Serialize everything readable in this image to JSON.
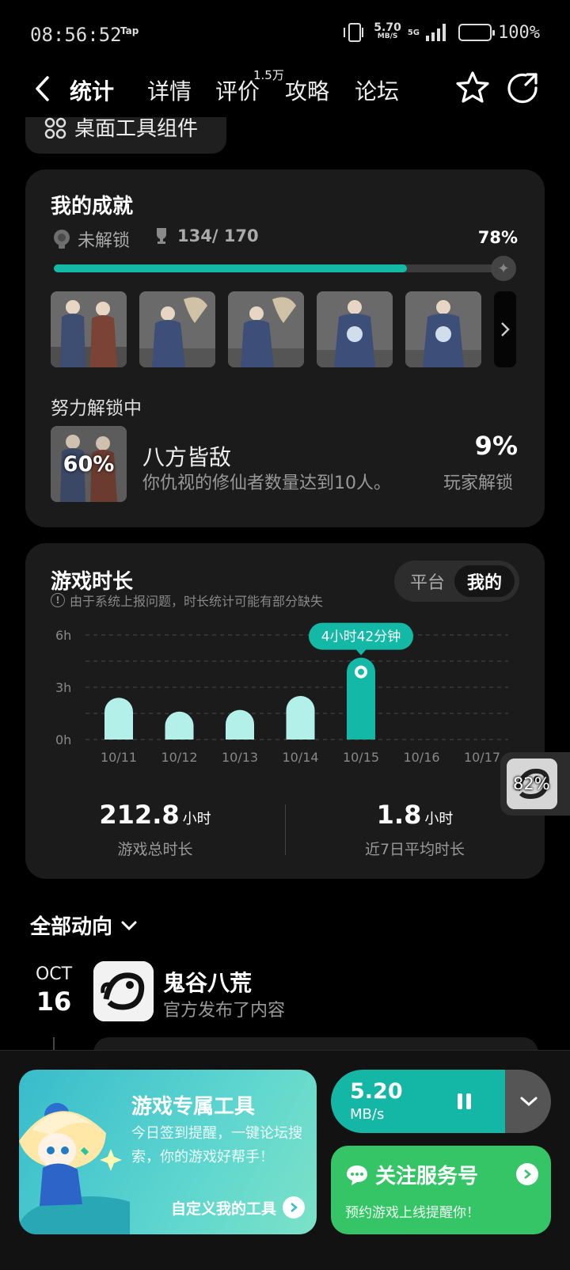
{
  "status": {
    "time": "08:56:52",
    "tap": "Tap",
    "net_speed": "5.70",
    "net_unit": "MB/S",
    "network": "5G",
    "battery": "100%"
  },
  "nav": {
    "tabs": [
      "统计",
      "详情",
      "评价",
      "攻略",
      "论坛"
    ],
    "review_count": "1.5万"
  },
  "widget_chip": {
    "label": "桌面工具组件"
  },
  "achievements": {
    "title": "我的成就",
    "locked_label": "未解锁",
    "count": "134/ 170",
    "percent": "78%",
    "progress": 0.78,
    "in_progress_title": "努力解锁中",
    "current": {
      "overlay": "60%",
      "name": "八方皆敌",
      "desc": "你仇视的修仙者数量达到10人。",
      "rate": "9%",
      "rate_label": "玩家解锁"
    }
  },
  "playtime": {
    "title": "游戏时长",
    "notice": "由于系统上报问题，时长统计可能有部分缺失",
    "toggle": [
      "平台",
      "我的"
    ],
    "selected": "我的",
    "total_value": "212.8",
    "total_unit": "小时",
    "total_caption": "游戏总时长",
    "avg_value": "1.8",
    "avg_unit": "小时",
    "avg_caption": "近7日平均时长"
  },
  "chart_data": {
    "type": "bar",
    "categories": [
      "10/11",
      "10/12",
      "10/13",
      "10/14",
      "10/15",
      "10/16",
      "10/17"
    ],
    "values": [
      2.4,
      1.6,
      1.7,
      2.5,
      4.7,
      0,
      0
    ],
    "yticks": [
      "6h",
      "3h",
      "0h"
    ],
    "ylim": [
      0,
      6
    ],
    "highlight_index": 4,
    "highlight_label": "4小时42分钟",
    "colors": {
      "bar": "#b3f0ea",
      "highlight": "#13b8a6"
    }
  },
  "float_widget": {
    "percent": "82%"
  },
  "activity": {
    "title": "全部动向",
    "month": "OCT",
    "day": "16",
    "app_name": "鬼谷八荒",
    "app_sub": "官方发布了内容"
  },
  "dock": {
    "tool_title": "游戏专属工具",
    "tool_desc": "今日签到提醒，一键论坛搜索，你的游戏好帮手！",
    "tool_link": "自定义我的工具",
    "download_speed": "5.20",
    "download_unit": "MB/s",
    "download_progress": 0.79,
    "service_title": "关注服务号",
    "service_desc": "预约游戏上线提醒你！"
  },
  "colors": {
    "accent": "#13b8a6",
    "card": "#1b1b1b",
    "green": "#35c567"
  }
}
